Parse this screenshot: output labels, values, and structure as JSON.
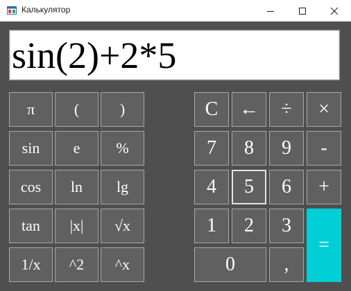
{
  "window": {
    "title": "Калькулятор",
    "icon": "app-window-icon",
    "controls": [
      "minimize-icon",
      "maximize-icon",
      "close-icon"
    ]
  },
  "display": {
    "expression": "sin(2)+2*5"
  },
  "keys": {
    "pi": "π",
    "lparen": "(",
    "rparen": ")",
    "sin": "sin",
    "e": "e",
    "percent": "%",
    "cos": "cos",
    "ln": "ln",
    "lg": "lg",
    "tan": "tan",
    "abs": "|x|",
    "sqrt": "√x",
    "reciprocal": "1/x",
    "square": "^2",
    "power": "^x",
    "clear": "C",
    "backspace": "←",
    "divide": "÷",
    "multiply": "×",
    "d7": "7",
    "d8": "8",
    "d9": "9",
    "minus": "-",
    "d4": "4",
    "d5": "5",
    "d6": "6",
    "plus": "+",
    "d1": "1",
    "d2": "2",
    "d3": "3",
    "equals": "=",
    "d0": "0",
    "comma": ","
  },
  "colors": {
    "background": "#4f4f4f",
    "key": "#606060",
    "key_border": "#a8a8a8",
    "equals": "#00cfd6"
  }
}
